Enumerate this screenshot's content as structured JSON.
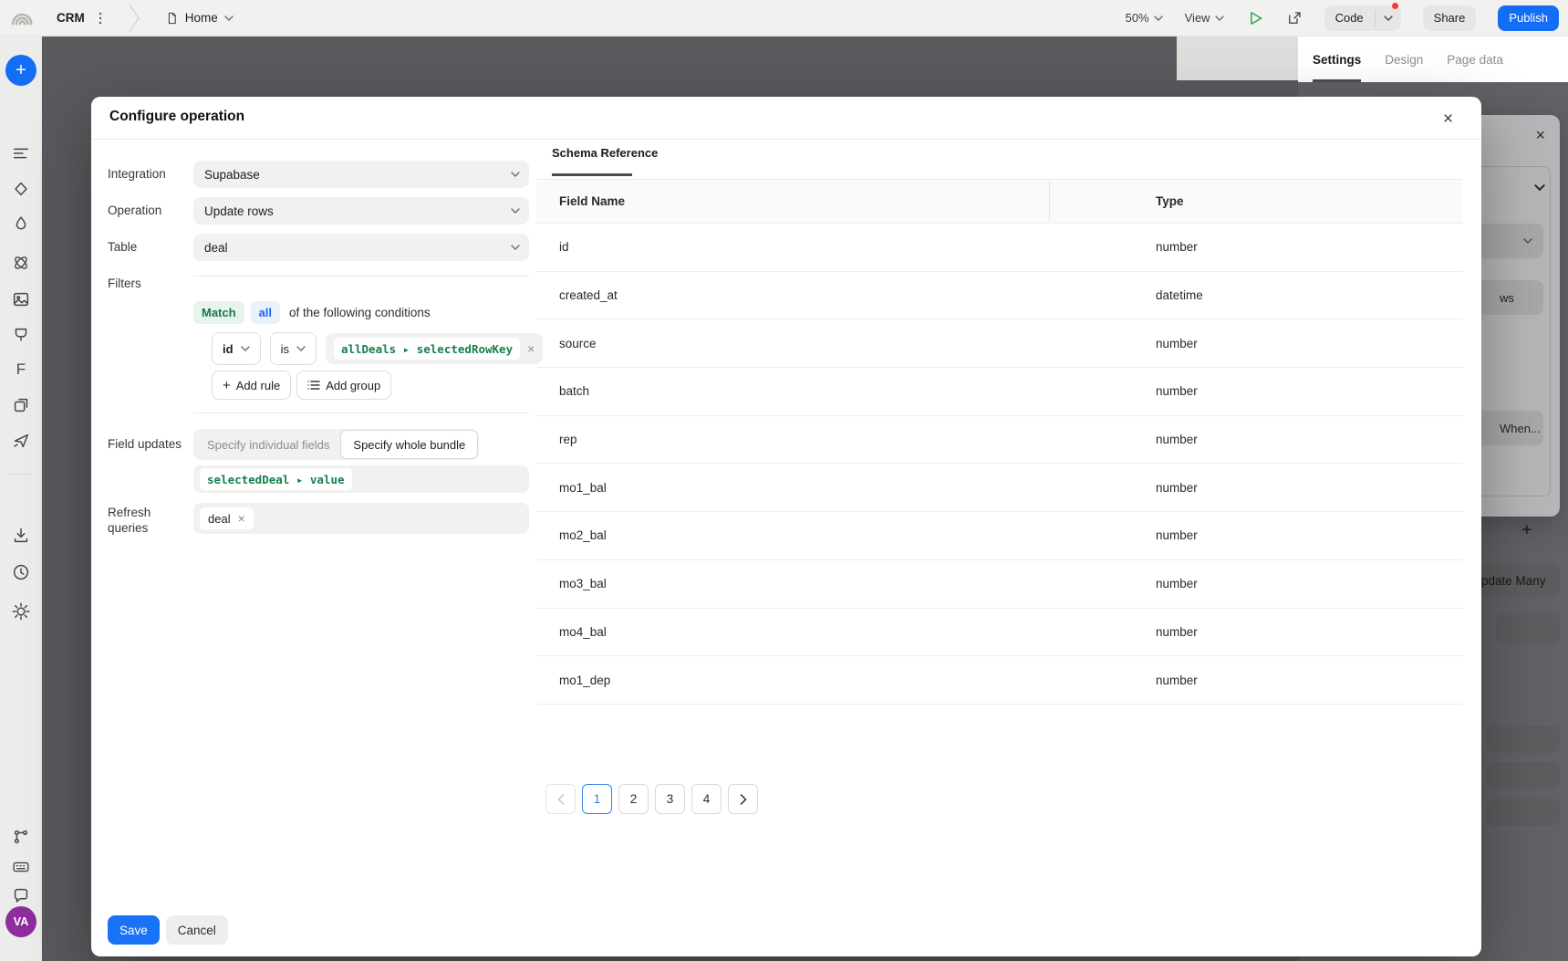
{
  "header": {
    "app_name": "CRM",
    "page_name": "Home",
    "zoom_level": "50%",
    "view_label": "View",
    "code_label": "Code",
    "share_label": "Share",
    "publish_label": "Publish"
  },
  "right_panel": {
    "tabs": [
      "Settings",
      "Design",
      "Page data"
    ],
    "active_tab": "Settings",
    "background_fragments": {
      "rows_pill": "ws",
      "when_button": "When...",
      "update_many": "pdate Many"
    }
  },
  "sidebar": {
    "avatar_initials": "VA"
  },
  "modal": {
    "title": "Configure operation",
    "integration_label": "Integration",
    "integration_value": "Supabase",
    "operation_label": "Operation",
    "operation_value": "Update rows",
    "table_label": "Table",
    "table_value": "deal",
    "filters_label": "Filters",
    "match_label": "Match",
    "match_mode": "all",
    "match_suffix": "of the following conditions",
    "rule_field": "id",
    "rule_operator": "is",
    "rule_value": "allDeals ▸ selectedRowKey",
    "add_rule_label": "Add rule",
    "add_group_label": "Add group",
    "field_updates_label": "Field updates",
    "segment_individual": "Specify individual fields",
    "segment_bundle": "Specify whole bundle",
    "bundle_value": "selectedDeal ▸ value",
    "refresh_label_line1": "Refresh",
    "refresh_label_line2": "queries",
    "refresh_tag": "deal",
    "save_label": "Save",
    "cancel_label": "Cancel"
  },
  "schema": {
    "tab_label": "Schema Reference",
    "columns": [
      "Field Name",
      "Type"
    ],
    "rows": [
      {
        "field": "id",
        "type": "number"
      },
      {
        "field": "created_at",
        "type": "datetime"
      },
      {
        "field": "source",
        "type": "number"
      },
      {
        "field": "batch",
        "type": "number"
      },
      {
        "field": "rep",
        "type": "number"
      },
      {
        "field": "mo1_bal",
        "type": "number"
      },
      {
        "field": "mo2_bal",
        "type": "number"
      },
      {
        "field": "mo3_bal",
        "type": "number"
      },
      {
        "field": "mo4_bal",
        "type": "number"
      },
      {
        "field": "mo1_dep",
        "type": "number"
      }
    ],
    "pagination": {
      "pages": [
        "1",
        "2",
        "3",
        "4"
      ],
      "active": "1"
    }
  },
  "colors": {
    "accent_blue": "#146ef5",
    "token_green": "#16814c",
    "match_green_bg": "#e7f3ec",
    "match_green_text": "#147a4d",
    "all_blue_bg": "#e9f1fd",
    "all_blue_text": "#1668f2",
    "pagination_active": "#2f80ed",
    "avatar_purple": "#8e2d9c",
    "notification_red": "#f13a3a"
  }
}
